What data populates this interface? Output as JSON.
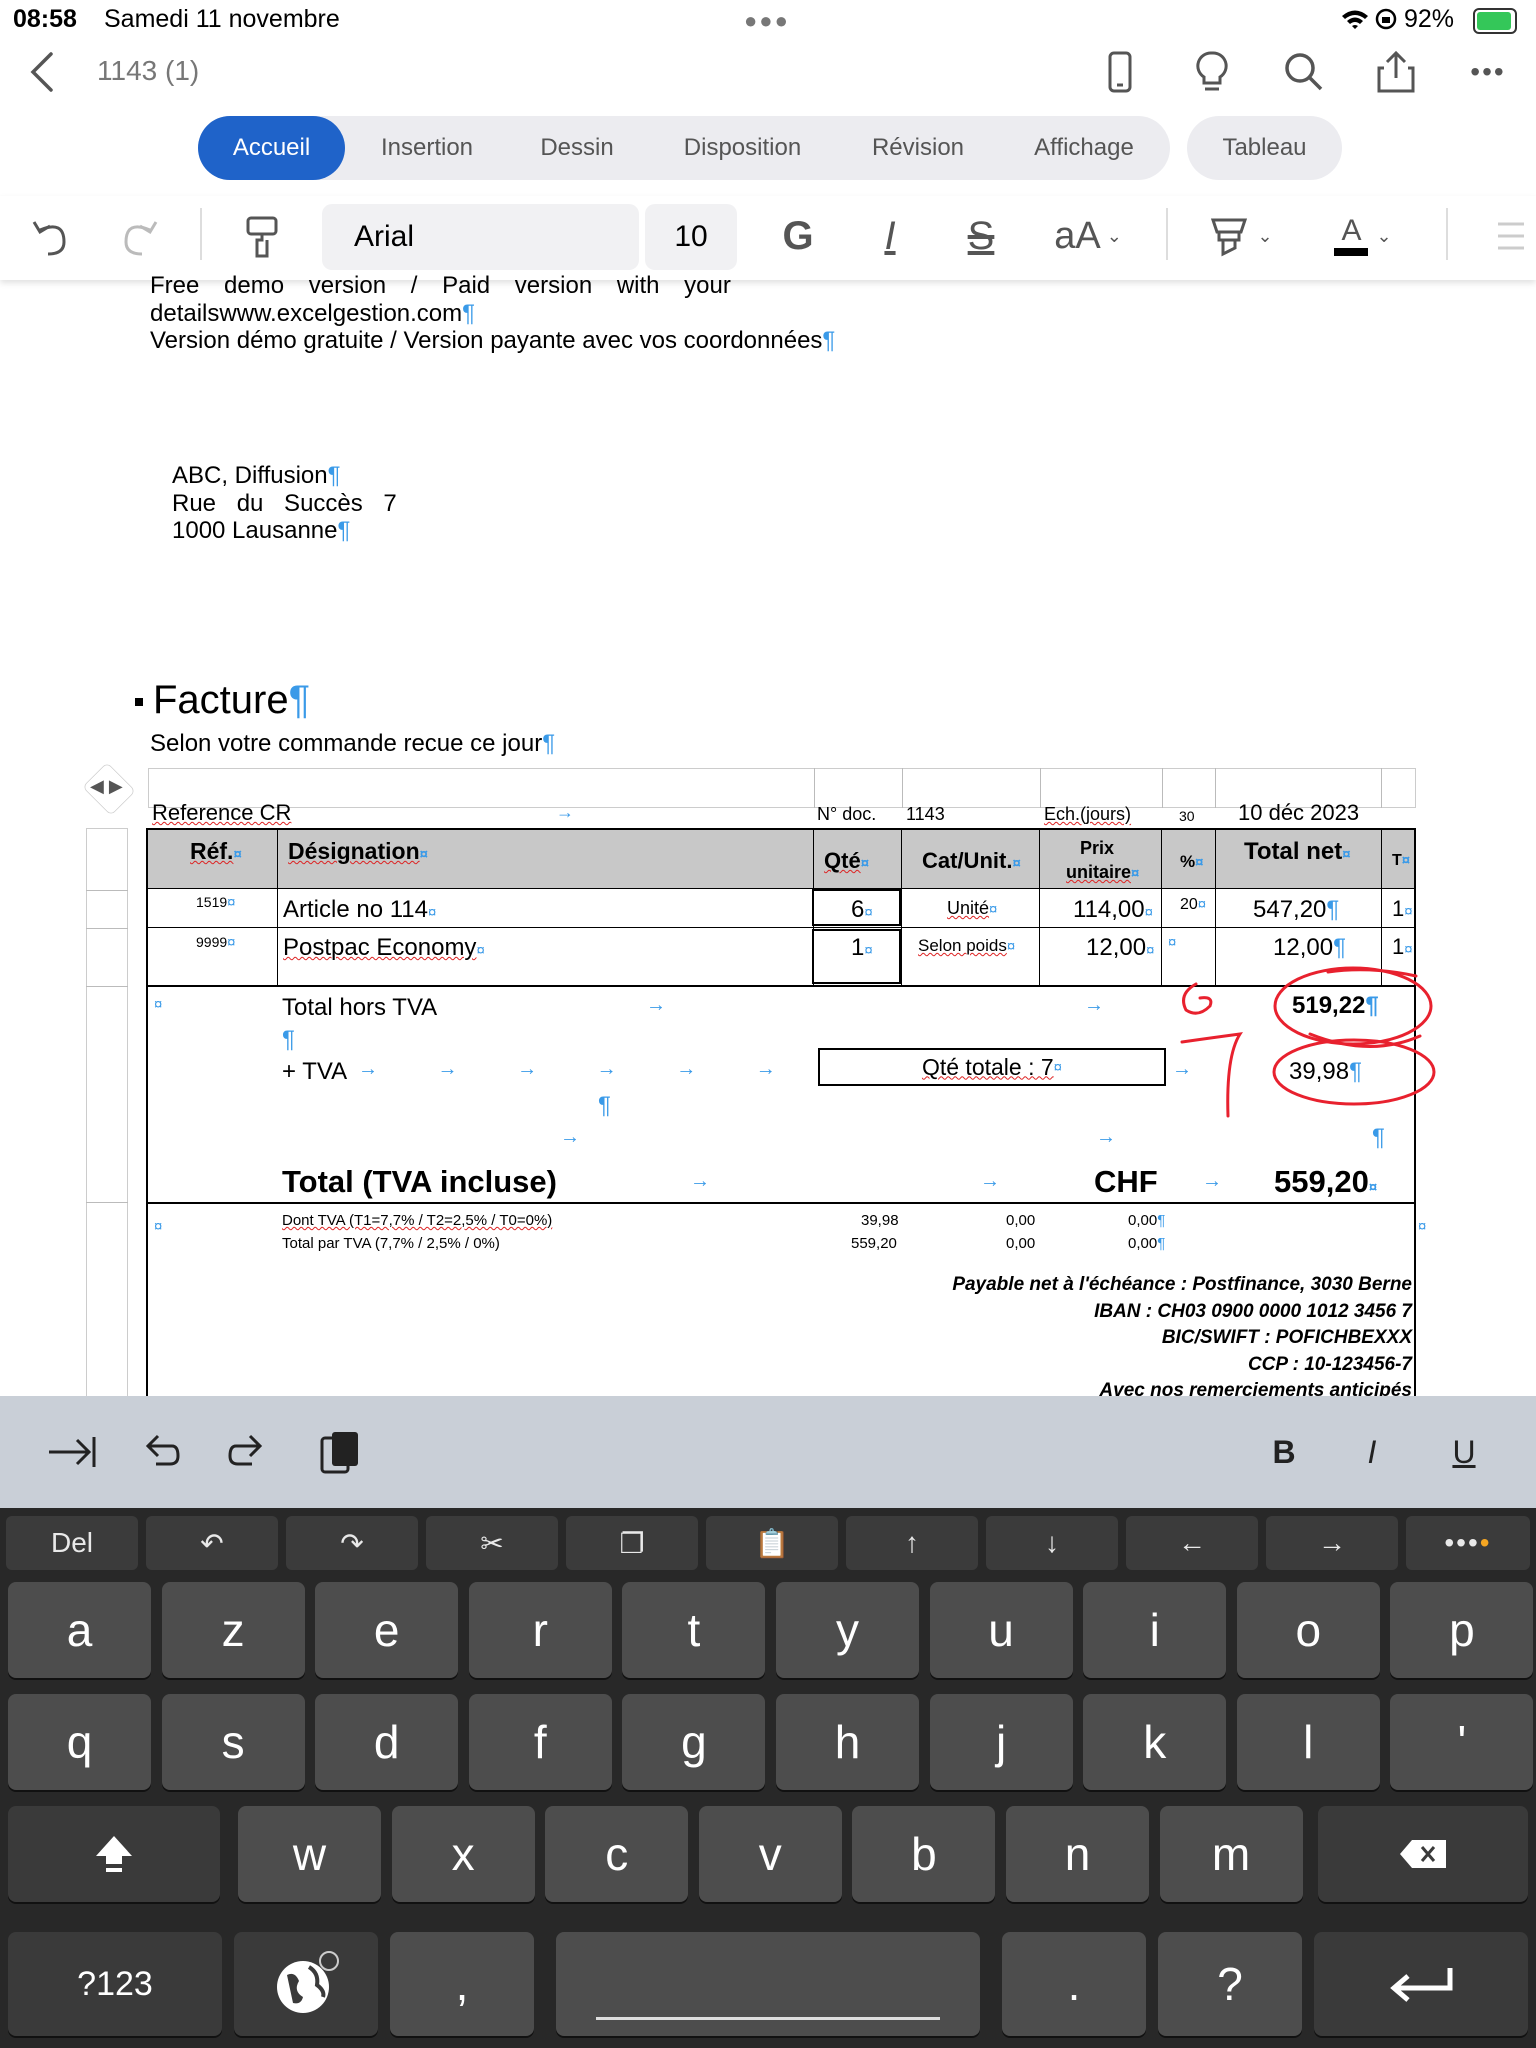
{
  "status_bar": {
    "time": "08:58",
    "date": "Samedi 11 novembre",
    "battery": "92%"
  },
  "title_bar": {
    "document_title": "1143 (1)"
  },
  "ribbon": {
    "tabs": [
      "Accueil",
      "Insertion",
      "Dessin",
      "Disposition",
      "Révision",
      "Affichage"
    ],
    "active_tab": "Accueil",
    "context_tab": "Tableau"
  },
  "toolbar": {
    "font_name": "Arial",
    "font_size": "10",
    "bold_glyph": "G",
    "italic_glyph": "I",
    "strike_glyph": "S",
    "size_glyph": "aA",
    "color_glyph": "A"
  },
  "document": {
    "header_lines": [
      "Free demo version / Paid version with your",
      "detailswww.excelgestion.com",
      "Version démo gratuite / Version payante avec vos coordonnées"
    ],
    "address": [
      "ABC, Diffusion",
      "Rue du Succès 7",
      "1000 Lausanne"
    ],
    "heading": "Facture",
    "subheading": "Selon votre commande recue ce jour",
    "ref_row": {
      "reference": "Reference CR",
      "doc_label": "N° doc.",
      "doc_value": "1143",
      "ech_label": "Ech.(jours)",
      "ech_value": "30",
      "date": "10 déc 2023"
    },
    "table_headers": {
      "ref": "Réf.",
      "designation": "Désignation",
      "qty": "Qté",
      "cat": "Cat/Unit.",
      "price_l1": "Prix",
      "price_l2": "unitaire",
      "pct": "%",
      "total": "Total net",
      "t": "T"
    },
    "rows": [
      {
        "ref": "1519",
        "designation": "Article no 114",
        "qty": "6",
        "cat": "Unité",
        "price": "114,00",
        "pct": "20",
        "total": "547,20",
        "t": "1"
      },
      {
        "ref": "9999",
        "designation": "Postpac Economy",
        "qty": "1",
        "cat": "Selon poids",
        "price": "12,00",
        "pct": "",
        "total": "12,00",
        "t": "1"
      }
    ],
    "totals": {
      "ht_label": "Total hors TVA",
      "ht_value": "519,22",
      "tva_label": "+ TVA",
      "qty_total": "Qté totale : 7",
      "tva_value": "39,98",
      "ttc_label": "Total (TVA incluse)",
      "currency": "CHF",
      "ttc_value": "559,20"
    },
    "tva_breakdown": [
      {
        "label": "Dont TVA (T1=7,7% / T2=2,5% / T0=0%)",
        "v1": "39,98",
        "v2": "0,00",
        "v3": "0,00"
      },
      {
        "label": "Total par TVA (7,7% / 2,5% / 0%)",
        "v1": "559,20",
        "v2": "0,00",
        "v3": "0,00"
      }
    ],
    "payment": [
      "Payable net à l'échéance : Postfinance, 3030 Berne",
      "IBAN : CH03 0900 0000 1012 3456 7",
      "BIC/SWIFT : POFICHBEXXX",
      "CCP : 10-123456-7",
      "Avec nos remerciements anticipés"
    ],
    "annotations": [
      "6",
      "7"
    ]
  },
  "keyboard_toolbar": {
    "bold": "B",
    "italic": "I",
    "underline": "U"
  },
  "keyboard": {
    "del": "Del",
    "row1": [
      "a",
      "z",
      "e",
      "r",
      "t",
      "y",
      "u",
      "i",
      "o",
      "p"
    ],
    "row2": [
      "q",
      "s",
      "d",
      "f",
      "g",
      "h",
      "j",
      "k",
      "l",
      "'"
    ],
    "row3": [
      "w",
      "x",
      "c",
      "v",
      "b",
      "n",
      "m"
    ],
    "numbers": "?123",
    "comma": ",",
    "period": ".",
    "question": "?"
  },
  "colors": {
    "accent": "#1f63c9",
    "pilcrow": "#3a9ae8",
    "annotation": "#e8212e",
    "keyboard_bg": "#282828"
  }
}
